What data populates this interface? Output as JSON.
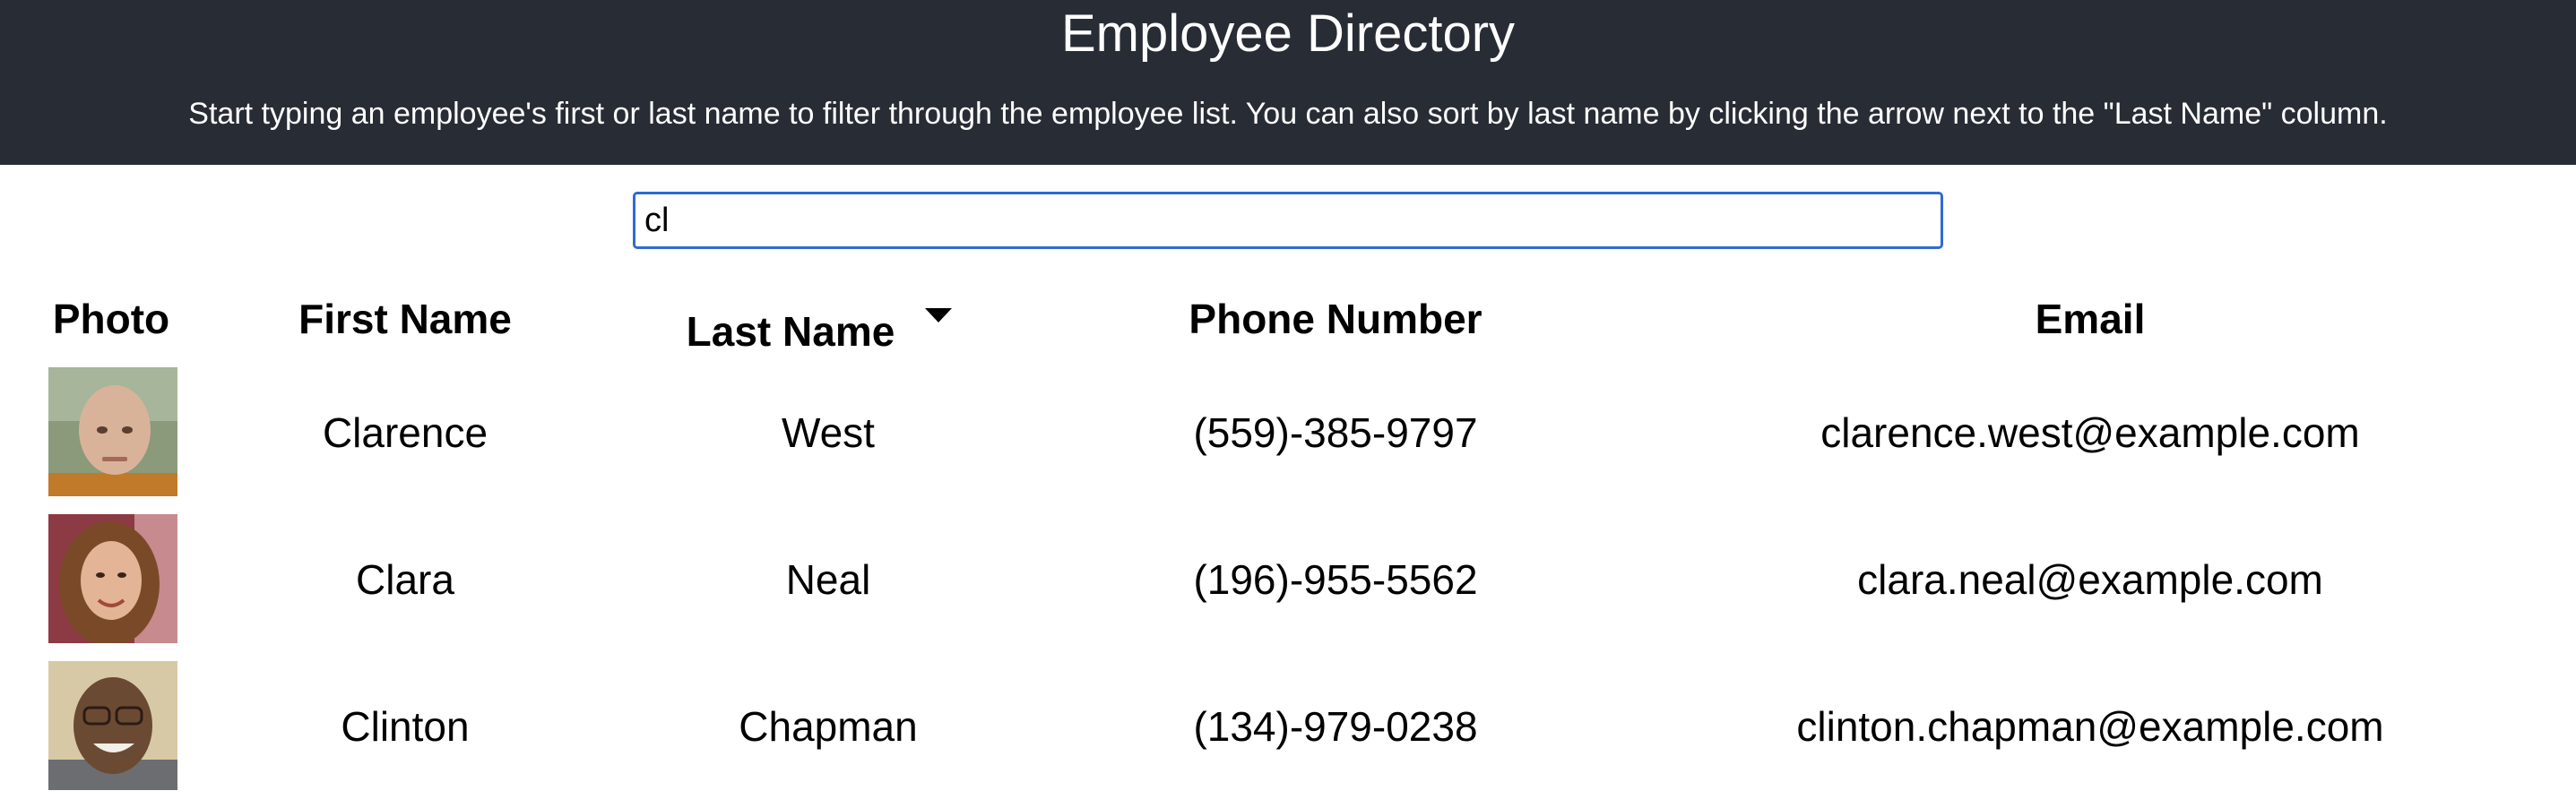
{
  "header": {
    "title": "Employee Directory",
    "subtitle": "Start typing an employee's first or last name to filter through the employee list. You can also sort by last name by clicking the arrow next to the \"Last Name\" column."
  },
  "search": {
    "value": "cl"
  },
  "table": {
    "columns": {
      "photo": "Photo",
      "first_name": "First Name",
      "last_name": "Last Name",
      "phone": "Phone Number",
      "email": "Email"
    },
    "sort_icon": "caret-down-icon",
    "rows": [
      {
        "first_name": "Clarence",
        "last_name": "West",
        "phone": "(559)-385-9797",
        "email": "clarence.west@example.com"
      },
      {
        "first_name": "Clara",
        "last_name": "Neal",
        "phone": "(196)-955-5562",
        "email": "clara.neal@example.com"
      },
      {
        "first_name": "Clinton",
        "last_name": "Chapman",
        "phone": "(134)-979-0238",
        "email": "clinton.chapman@example.com"
      }
    ]
  },
  "colors": {
    "header_bg": "#282c34",
    "input_border": "#2f6bd1"
  }
}
